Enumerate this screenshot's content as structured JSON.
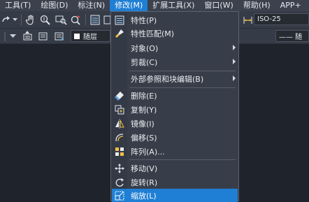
{
  "menubar": {
    "items": [
      {
        "label": "工具(T)"
      },
      {
        "label": "绘图(D)"
      },
      {
        "label": "标注(N)"
      },
      {
        "label": "修改(M)"
      },
      {
        "label": "扩展工具(X)"
      },
      {
        "label": "窗口(W)"
      },
      {
        "label": "帮助(H)"
      },
      {
        "label": "APP+"
      }
    ],
    "active_index": 3
  },
  "toolbar": {
    "dimstyle_value": "ISO-25",
    "layer_value": "随层",
    "linetype_value": "—— 随"
  },
  "dropdown": {
    "items": [
      {
        "label": "特性(P)",
        "icon": "properties-icon"
      },
      {
        "label": "特性匹配(M)",
        "icon": "match-properties-brush-icon"
      },
      {
        "label": "对象(O)",
        "submenu": true
      },
      {
        "label": "剪裁(C)",
        "submenu": true
      },
      {
        "label": "外部参照和块编辑(B)",
        "submenu": true
      },
      {
        "label": "删除(E)",
        "icon": "eraser-icon"
      },
      {
        "label": "复制(Y)",
        "icon": "copy-icon"
      },
      {
        "label": "镜像(I)",
        "icon": "mirror-icon"
      },
      {
        "label": "偏移(S)",
        "icon": "offset-icon"
      },
      {
        "label": "阵列(A)...",
        "icon": "array-icon"
      },
      {
        "label": "移动(V)",
        "icon": "move-icon"
      },
      {
        "label": "旋转(R)",
        "icon": "rotate-icon"
      },
      {
        "label": "缩放(L)",
        "icon": "scale-icon",
        "highlighted": true
      }
    ]
  },
  "colors": {
    "menu_highlight": "#1f7fd4",
    "menubar_bg": "#3b414d",
    "menu_bg": "#383e49"
  }
}
